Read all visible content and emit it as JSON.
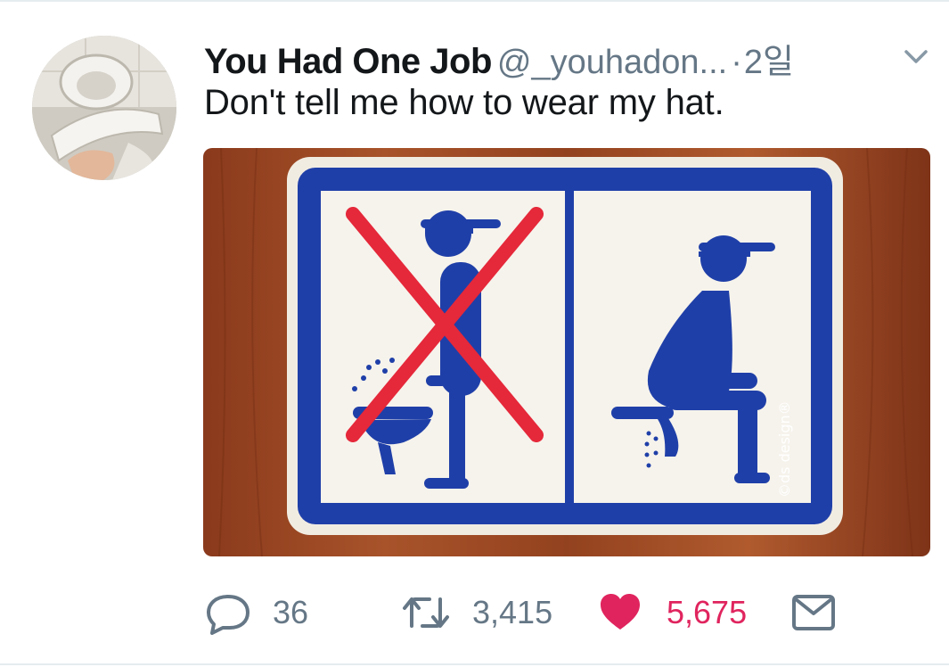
{
  "tweet": {
    "author": {
      "display_name": "You Had One Job",
      "handle": "@_youhadon...",
      "avatar_icon": "avatar-icon"
    },
    "separator": "·",
    "timestamp": "2일",
    "text": "Don't tell me how to wear my hat.",
    "media": {
      "sign_watermark": "©ds design®"
    },
    "actions": {
      "reply": {
        "icon": "reply-icon",
        "count": "36"
      },
      "retweet": {
        "icon": "retweet-icon",
        "count": "3,415"
      },
      "like": {
        "icon": "heart-icon",
        "count": "5,675",
        "active": true
      },
      "dm": {
        "icon": "envelope-icon"
      }
    }
  },
  "colors": {
    "text_primary": "#14171a",
    "text_secondary": "#657786",
    "like_active": "#e0245e",
    "sign_blue": "#1f3fa8",
    "sign_red": "#e5283a"
  }
}
